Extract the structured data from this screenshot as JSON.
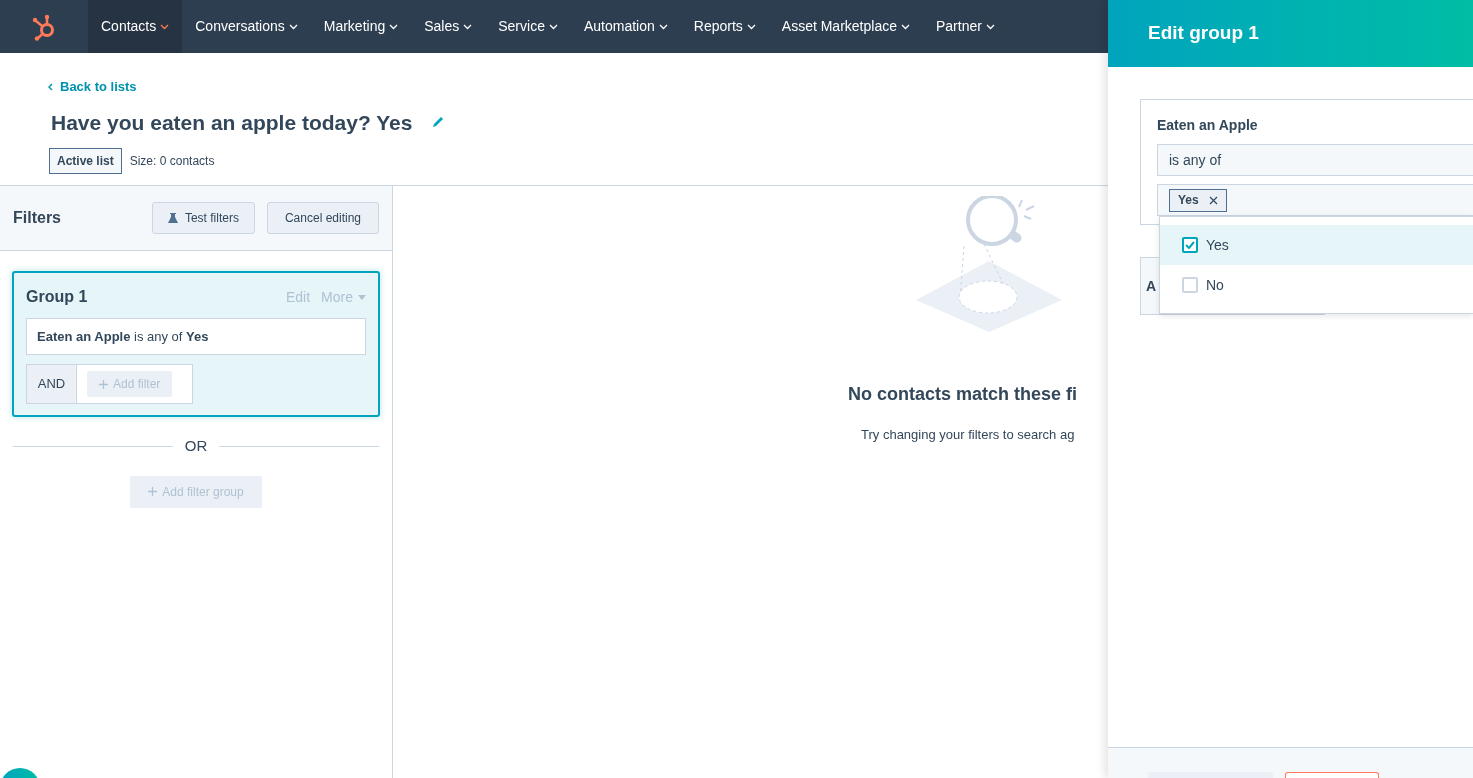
{
  "nav": {
    "items": [
      {
        "label": "Contacts",
        "selected": true
      },
      {
        "label": "Conversations",
        "selected": false
      },
      {
        "label": "Marketing",
        "selected": false
      },
      {
        "label": "Sales",
        "selected": false
      },
      {
        "label": "Service",
        "selected": false
      },
      {
        "label": "Automation",
        "selected": false
      },
      {
        "label": "Reports",
        "selected": false
      },
      {
        "label": "Asset Marketplace",
        "selected": false
      },
      {
        "label": "Partner",
        "selected": false
      }
    ]
  },
  "header": {
    "back_link": "Back to lists",
    "title": "Have you eaten an apple today? Yes",
    "badge": "Active list",
    "size": "Size: 0 contacts"
  },
  "filters": {
    "title": "Filters",
    "test_button": "Test filters",
    "cancel_button": "Cancel editing",
    "group": {
      "title": "Group 1",
      "edit": "Edit",
      "more": "More",
      "condition": "**Eaten an Apple** is any of **Yes**",
      "and_label": "AND",
      "add_filter": "Add filter"
    },
    "or_label": "OR",
    "add_group": "Add filter group"
  },
  "empty_state": {
    "heading": "No contacts match these fi",
    "text": "Try changing your filters to search ag"
  },
  "panel": {
    "title": "Edit group 1",
    "field_label": "Eaten an Apple",
    "operator": "is any of",
    "tags": [
      {
        "label": "Yes"
      }
    ],
    "options": [
      {
        "label": "Yes",
        "checked": true,
        "highlighted": true
      },
      {
        "label": "No",
        "checked": false,
        "highlighted": false
      }
    ],
    "second_card_label": "A"
  }
}
